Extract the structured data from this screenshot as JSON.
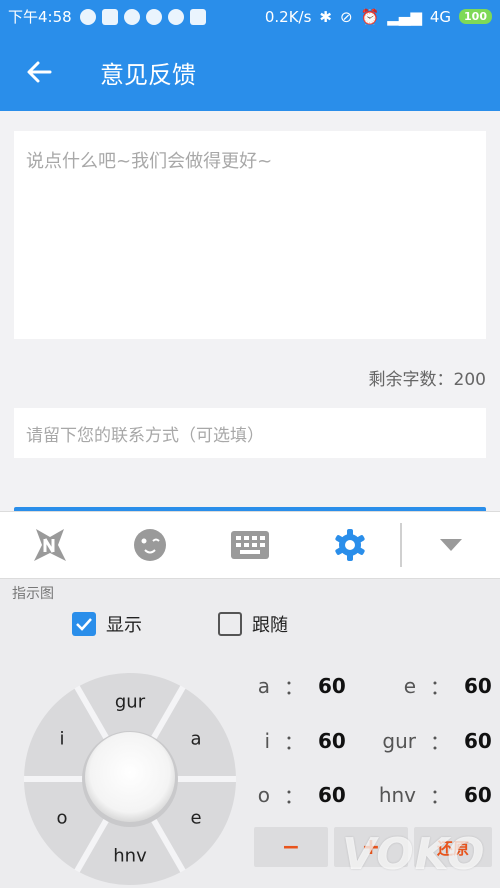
{
  "status_bar": {
    "time": "下午4:58",
    "network_speed": "0.2K/s",
    "signal": "4G",
    "battery": "100"
  },
  "app_bar": {
    "title": "意见反馈",
    "back_icon": "arrow-left-icon"
  },
  "feedback": {
    "placeholder": "说点什么吧~我们会做得更好~",
    "counter": "剩余字数：200",
    "contact_placeholder": "请留下您的联系方式（可选填）"
  },
  "keyboard_toolbar": {
    "icons": [
      "logo-icon",
      "emoji-icon",
      "keyboard-icon",
      "settings-icon",
      "collapse-icon"
    ],
    "active": "settings-icon"
  },
  "panel": {
    "label": "指示图",
    "show_label": "显示",
    "show_checked": true,
    "follow_label": "跟随",
    "follow_checked": false,
    "wheel": {
      "top": "gur",
      "left": "i",
      "right": "a",
      "bottom_left": "o",
      "bottom_right": "e",
      "bottom": "hnv"
    },
    "params": [
      {
        "key": "a",
        "value": "60"
      },
      {
        "key": "e",
        "value": "60"
      },
      {
        "key": "i",
        "value": "60"
      },
      {
        "key": "gur",
        "value": "60"
      },
      {
        "key": "o",
        "value": "60"
      },
      {
        "key": "hnv",
        "value": "60"
      }
    ],
    "colon": "：",
    "minus_label": "−",
    "plus_label": "+",
    "reset_label": "还原"
  },
  "watermark": "VOKO",
  "colors": {
    "primary": "#2a8eea",
    "accent": "#e8541c"
  }
}
